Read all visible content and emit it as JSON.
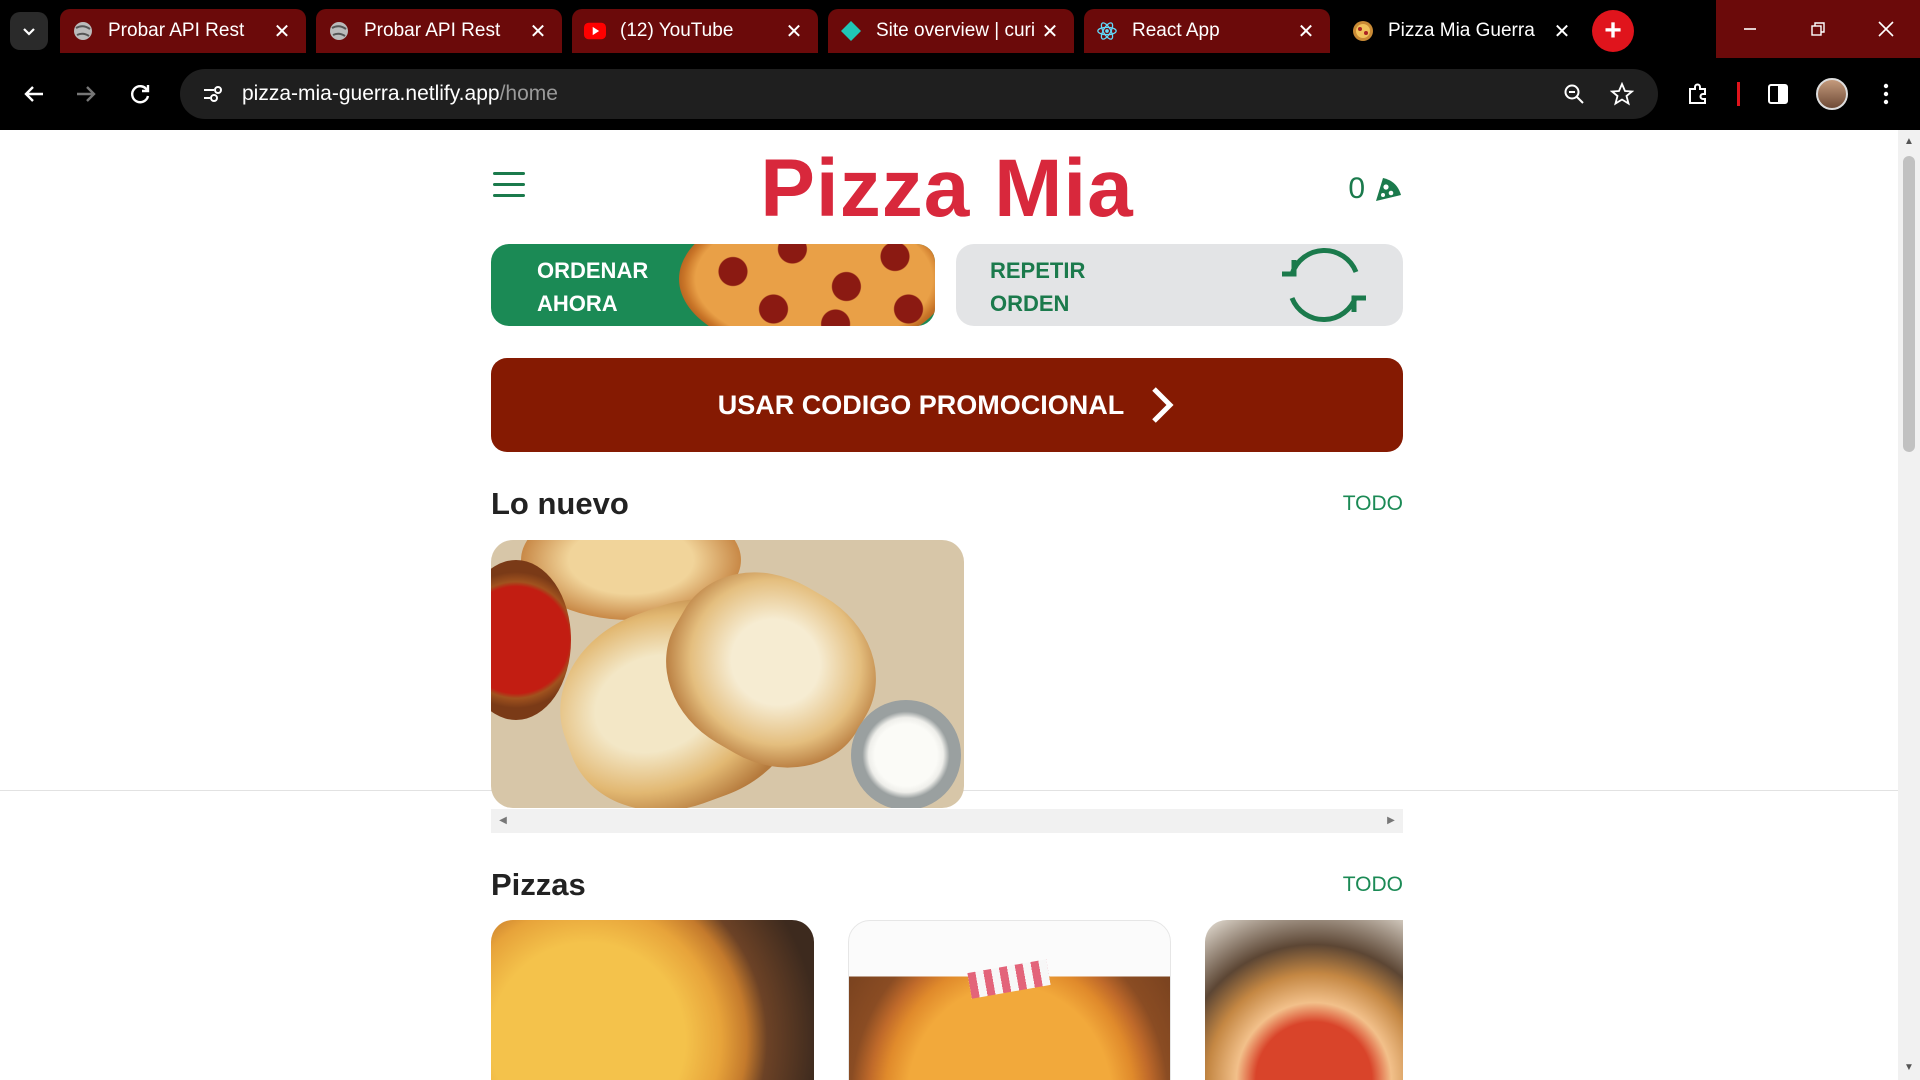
{
  "browser": {
    "tabs": [
      {
        "title": "Probar API Rest",
        "icon": "globe-icon"
      },
      {
        "title": "Probar API Rest",
        "icon": "globe-icon"
      },
      {
        "title": "(12) YouTube",
        "icon": "youtube-icon"
      },
      {
        "title": "Site overview | curi",
        "icon": "netlify-icon"
      },
      {
        "title": "React App",
        "icon": "react-icon"
      },
      {
        "title": "Pizza Mia Guerra",
        "icon": "pizza-favicon",
        "active": true
      }
    ],
    "close_glyph": "✕",
    "new_tab_glyph": "+",
    "url_host": "pizza-mia-guerra.netlify.app",
    "url_path": "/home",
    "accent_color": "#6b0a0a"
  },
  "header": {
    "brand": "Pizza Mia",
    "cart_count": "0",
    "brand_color": "#d8283c"
  },
  "actions": {
    "order_line1": "ORDENAR",
    "order_line2": "AHORA",
    "repeat_line1": "REPETIR",
    "repeat_line2": "ORDEN",
    "promo_label": "USAR CODIGO PROMOCIONAL",
    "green_color": "#1b8a55",
    "promo_color": "#851a02"
  },
  "sections": {
    "new": {
      "title": "Lo nuevo",
      "link": "TODO"
    },
    "pizzas": {
      "title": "Pizzas",
      "link": "TODO"
    }
  }
}
